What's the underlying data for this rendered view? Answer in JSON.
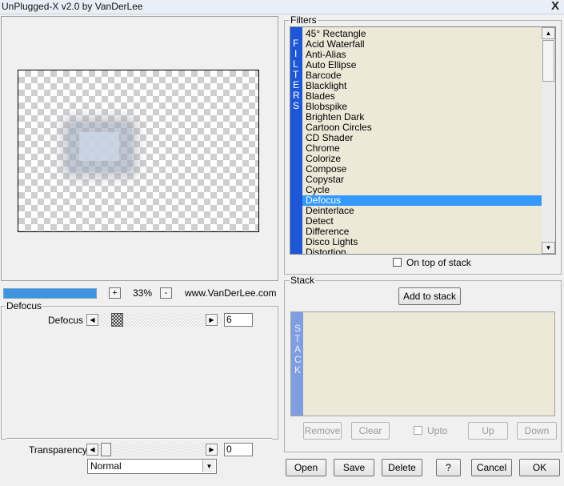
{
  "window": {
    "title": "UnPlugged-X v2.0 by VanDerLee",
    "close_glyph": "X"
  },
  "preview": {
    "zoom": "33%",
    "zoom_in": "+",
    "zoom_out": "-",
    "website": "www.VanDerLee.com"
  },
  "params": {
    "group_label": "Defocus",
    "defocus": {
      "label": "Defocus",
      "value": "6"
    },
    "transparency": {
      "label": "Transparency",
      "value": "0"
    },
    "blend_mode": "Normal"
  },
  "filters": {
    "group_label": "Filters",
    "band_letters": [
      "F",
      "I",
      "L",
      "T",
      "E",
      "R",
      "S"
    ],
    "items": [
      "45° Rectangle",
      "Acid Waterfall",
      "Anti-Alias",
      "Auto Ellipse",
      "Barcode",
      "Blacklight",
      "Blades",
      "Blobspike",
      "Brighten Dark",
      "Cartoon Circles",
      "CD Shader",
      "Chrome",
      "Colorize",
      "Compose",
      "Copystar",
      "Cycle",
      "Defocus",
      "Deinterlace",
      "Detect",
      "Difference",
      "Disco Lights",
      "Distortion"
    ],
    "selected": "Defocus",
    "on_top_label": "On top of stack"
  },
  "stack": {
    "group_label": "Stack",
    "add_label": "Add to stack",
    "band_letters": [
      "S",
      "T",
      "A",
      "C",
      "K"
    ],
    "remove_label": "Remove",
    "clear_label": "Clear",
    "upto_label": "Upto",
    "up_label": "Up",
    "down_label": "Down"
  },
  "buttons": {
    "open": "Open",
    "save": "Save",
    "delete": "Delete",
    "help": "?",
    "cancel": "Cancel",
    "ok": "OK"
  },
  "colors": {
    "selection": "#3399ff",
    "filters_band": "#1e57d6",
    "stack_band": "#7f9ee0",
    "progress": "#3d95e0"
  }
}
